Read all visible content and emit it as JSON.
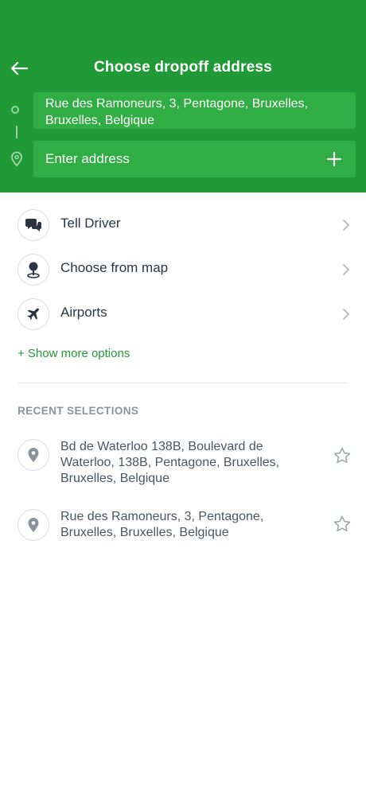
{
  "header": {
    "title": "Choose dropoff address",
    "pickup_address": "Rue des Ramoneurs, 3, Pentagone, Bruxelles, Bruxelles, Belgique",
    "dropoff_placeholder": "Enter address",
    "dropoff_value": ""
  },
  "options": [
    {
      "label": "Tell Driver",
      "icon": "chat-bubbles-icon"
    },
    {
      "label": "Choose from map",
      "icon": "map-pin-icon"
    },
    {
      "label": "Airports",
      "icon": "airplane-icon"
    }
  ],
  "show_more_label": "+ Show more options",
  "recent_section_title": "RECENT SELECTIONS",
  "recent": [
    {
      "address": "Bd de Waterloo 138B, Boulevard de Waterloo, 138B, Pentagone, Bruxelles, Bruxelles, Belgique"
    },
    {
      "address": "Rue des Ramoneurs, 3, Pentagone, Bruxelles, Bruxelles, Belgique"
    }
  ],
  "colors": {
    "brand_green": "#1f9a36",
    "field_green": "#30ad43",
    "link_green": "#21973a"
  }
}
